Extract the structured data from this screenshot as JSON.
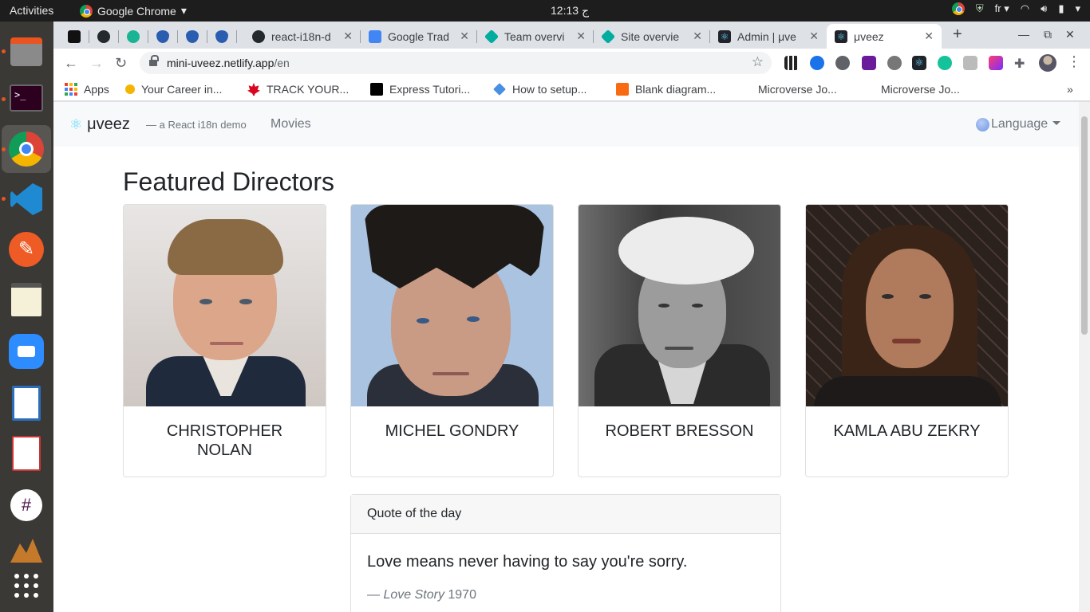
{
  "topbar": {
    "activities": "Activities",
    "app_name": "Google Chrome",
    "clock": "12:13 ج",
    "keyboard": "fr"
  },
  "tabs": [
    {
      "label": "",
      "color": "#111111"
    },
    {
      "label": "",
      "color": "#24292e"
    },
    {
      "label": "",
      "color": "#1ab394"
    },
    {
      "label": "",
      "color": "#2a5db0"
    },
    {
      "label": "",
      "color": "#2a5db0"
    },
    {
      "label": "",
      "color": "#2a5db0"
    },
    {
      "label": "react-i18n-d",
      "color": "#24292e"
    },
    {
      "label": "Google Trad",
      "color": "#4285f4"
    },
    {
      "label": "Team overvi",
      "color": "#00ad9f"
    },
    {
      "label": "Site overvie",
      "color": "#00ad9f"
    },
    {
      "label": "Admin | μve",
      "color": "#20232a"
    },
    {
      "label": "μveez",
      "color": "#20232a"
    }
  ],
  "toolbar": {
    "url_host": "mini-uveez.netlify.app",
    "url_path": "/en"
  },
  "bookmarks": [
    {
      "label": "Apps",
      "color": "#ea4335"
    },
    {
      "label": "Your Career in...",
      "color": "#f4b400"
    },
    {
      "label": "TRACK YOUR...",
      "color": "#d80621"
    },
    {
      "label": "Express Tutori...",
      "color": "#000000"
    },
    {
      "label": "How to setup...",
      "color": "#4a90e2"
    },
    {
      "label": "Blank diagram...",
      "color": "#f96b13"
    },
    {
      "label": "Microverse Jo...",
      "color": ""
    },
    {
      "label": "Microverse Jo...",
      "color": ""
    }
  ],
  "navbar": {
    "brand": "μveez",
    "tagline": "— a React i18n demo",
    "movies": "Movies",
    "language": "Language"
  },
  "page": {
    "heading": "Featured Directors",
    "directors": [
      {
        "name": "CHRISTOPHER NOLAN"
      },
      {
        "name": "MICHEL GONDRY"
      },
      {
        "name": "ROBERT BRESSON"
      },
      {
        "name": "KAMLA ABU ZEKRY"
      }
    ],
    "quote": {
      "header": "Quote of the day",
      "text": "Love means never having to say you're sorry.",
      "source_dash": "— ",
      "source_title": "Love Story",
      "source_year": " 1970"
    }
  }
}
